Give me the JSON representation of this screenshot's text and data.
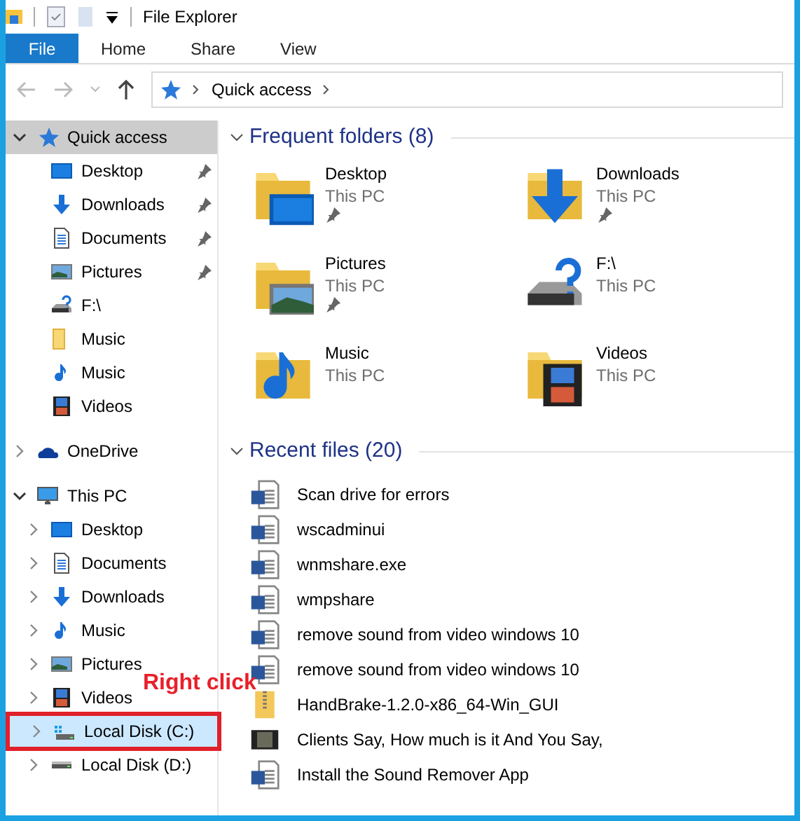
{
  "window": {
    "title": "File Explorer"
  },
  "ribbon_tabs": [
    {
      "label": "File",
      "selected": true
    },
    {
      "label": "Home",
      "selected": false
    },
    {
      "label": "Share",
      "selected": false
    },
    {
      "label": "View",
      "selected": false
    }
  ],
  "address_bar": {
    "path": [
      "Quick access"
    ]
  },
  "navigation": [
    {
      "label": "Quick access",
      "kind": "star",
      "expanded": true,
      "selected": true,
      "children": [
        {
          "label": "Desktop",
          "kind": "desktop",
          "pinned": true
        },
        {
          "label": "Downloads",
          "kind": "downloads",
          "pinned": true
        },
        {
          "label": "Documents",
          "kind": "documents",
          "pinned": true
        },
        {
          "label": "Pictures",
          "kind": "pictures",
          "pinned": true
        },
        {
          "label": "F:\\",
          "kind": "drive-unknown",
          "pinned": false
        },
        {
          "label": "Music",
          "kind": "folder",
          "pinned": false
        },
        {
          "label": "Music",
          "kind": "music",
          "pinned": false
        },
        {
          "label": "Videos",
          "kind": "videos",
          "pinned": false
        }
      ]
    },
    {
      "label": "OneDrive",
      "kind": "cloud",
      "expanded": false,
      "selected": false
    },
    {
      "label": "This PC",
      "kind": "pc",
      "expanded": true,
      "selected": false,
      "children": [
        {
          "label": "Desktop",
          "kind": "desktop",
          "expanded": false
        },
        {
          "label": "Documents",
          "kind": "documents",
          "expanded": false
        },
        {
          "label": "Downloads",
          "kind": "downloads",
          "expanded": false
        },
        {
          "label": "Music",
          "kind": "music",
          "expanded": false
        },
        {
          "label": "Pictures",
          "kind": "pictures",
          "expanded": false
        },
        {
          "label": "Videos",
          "kind": "videos",
          "expanded": false
        },
        {
          "label": "Local Disk (C:)",
          "kind": "drive-windows",
          "expanded": false,
          "highlighted": true
        },
        {
          "label": "Local Disk (D:)",
          "kind": "drive",
          "expanded": false,
          "highlighted": false
        }
      ]
    }
  ],
  "annotation": {
    "text": "Right click"
  },
  "frequent_folders": {
    "title": "Frequent folders (8)",
    "expanded": true,
    "items": [
      {
        "name": "Desktop",
        "location": "This PC",
        "kind": "desktop",
        "pinned": true
      },
      {
        "name": "Downloads",
        "location": "This PC",
        "kind": "downloads",
        "pinned": true
      },
      {
        "name": "Pictures",
        "location": "This PC",
        "kind": "pictures",
        "pinned": true
      },
      {
        "name": "F:\\",
        "location": "This PC",
        "kind": "drive-unknown",
        "pinned": false
      },
      {
        "name": "Music",
        "location": "This PC",
        "kind": "music",
        "pinned": false
      },
      {
        "name": "Videos",
        "location": "This PC",
        "kind": "videos",
        "pinned": false
      }
    ]
  },
  "recent_files": {
    "title": "Recent files (20)",
    "expanded": true,
    "items": [
      {
        "name": "Scan drive for errors",
        "kind": "word"
      },
      {
        "name": "wscadminui",
        "kind": "word"
      },
      {
        "name": "wnmshare.exe",
        "kind": "word"
      },
      {
        "name": "wmpshare",
        "kind": "word"
      },
      {
        "name": "remove sound from video windows 10",
        "kind": "word"
      },
      {
        "name": "remove sound from video windows 10",
        "kind": "word"
      },
      {
        "name": "HandBrake-1.2.0-x86_64-Win_GUI",
        "kind": "zip"
      },
      {
        "name": "Clients Say, How much is it And You Say,",
        "kind": "video-file"
      },
      {
        "name": "Install the Sound Remover App",
        "kind": "word"
      }
    ]
  }
}
